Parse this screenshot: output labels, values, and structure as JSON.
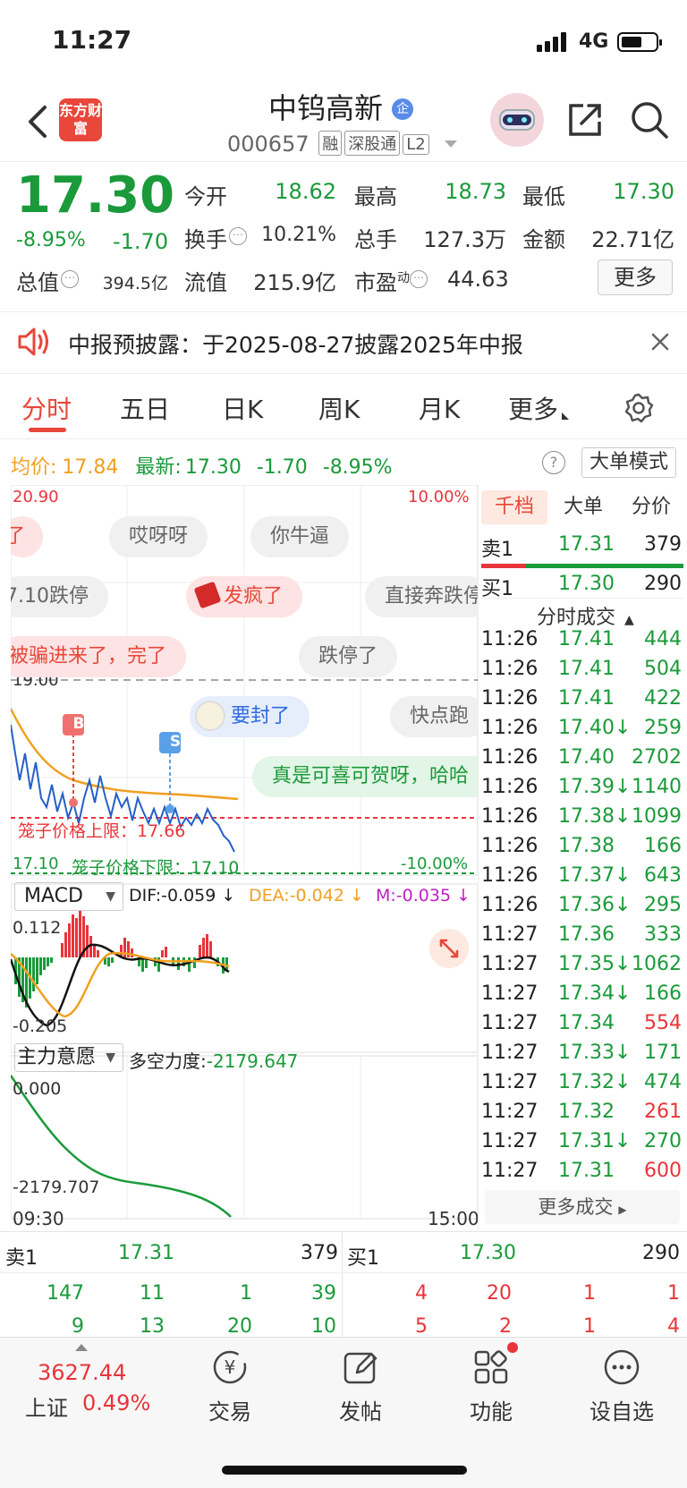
{
  "status": {
    "time": "11:27",
    "network": "4G"
  },
  "header": {
    "logo_text": "东方财富",
    "stock_name": "中钨高新",
    "badge": "企",
    "stock_code": "000657",
    "tags": [
      "融",
      "深股通",
      "L2"
    ]
  },
  "quote": {
    "price": "17.30",
    "pct": "-8.95%",
    "change": "-1.70",
    "open_label": "今开",
    "open": "18.62",
    "high_label": "最高",
    "high": "18.73",
    "low_label": "最低",
    "low": "17.30",
    "turnover_label": "换手",
    "turnover": "10.21%",
    "volume_label": "总手",
    "volume": "127.3万",
    "amount_label": "金额",
    "amount": "22.71亿",
    "mcap_label": "总值",
    "mcap": "394.5亿",
    "float_label": "流值",
    "float": "215.9亿",
    "pe_label": "市盈",
    "pe_sup": "动",
    "pe": "44.63",
    "more_label": "更多"
  },
  "notice": {
    "text": "中报预披露：于2025-08-27披露2025年中报"
  },
  "tabs": [
    "分时",
    "五日",
    "日K",
    "周K",
    "月K",
    "更多"
  ],
  "chart": {
    "avg_label": "均价:",
    "avg": "17.84",
    "latest_label": "最新:",
    "latest": "17.30",
    "latest_change": "-1.70",
    "latest_pct": "-8.95%",
    "big_order_mode": "大单模式",
    "top_price": "20.90",
    "top_pct": "10.00%",
    "mid_price": "19.00",
    "bottom_price": "17.10",
    "bottom_pct": "-10.00%",
    "upper_limit_text": "笼子价格上限：17.66",
    "lower_limit_text": "笼子价格下限：17.10",
    "b_marker": "B",
    "s_marker": "S",
    "time_start": "09:30",
    "time_end": "15:00",
    "bubbles": [
      "了",
      "哎呀呀",
      "你牛逼",
      "7.10跌停",
      "发疯了",
      "直接奔跌停",
      "被骗进来了，完了",
      "跌停了",
      "要封了",
      "快点跑",
      "真是可喜可贺呀，哈哈"
    ]
  },
  "macd": {
    "label": "MACD",
    "dif": "DIF:-0.059 ↓",
    "dea": "DEA:-0.042 ↓",
    "m": "M:-0.035 ↓",
    "top": "0.112",
    "bottom": "-0.205"
  },
  "flow": {
    "label": "主力意愿",
    "force_label": "多空力度:",
    "force": "-2179.647",
    "top": "0.000",
    "bottom": "-2179.707"
  },
  "orderbook": {
    "tabs": [
      "千档",
      "大单",
      "分价"
    ],
    "sell1_label": "卖1",
    "sell1_price": "17.31",
    "sell1_vol": "379",
    "buy1_label": "买1",
    "buy1_price": "17.30",
    "buy1_vol": "290",
    "trades_title": "分时成交",
    "trades": [
      {
        "t": "11:26",
        "p": "17.41",
        "v": "444",
        "c": "g"
      },
      {
        "t": "11:26",
        "p": "17.41",
        "v": "504",
        "c": "g"
      },
      {
        "t": "11:26",
        "p": "17.41",
        "v": "422",
        "c": "g"
      },
      {
        "t": "11:26",
        "p": "17.40↓",
        "v": "259",
        "c": "g"
      },
      {
        "t": "11:26",
        "p": "17.40",
        "v": "2702",
        "c": "g"
      },
      {
        "t": "11:26",
        "p": "17.39↓",
        "v": "1140",
        "c": "g"
      },
      {
        "t": "11:26",
        "p": "17.38↓",
        "v": "1099",
        "c": "g"
      },
      {
        "t": "11:26",
        "p": "17.38",
        "v": "166",
        "c": "g"
      },
      {
        "t": "11:26",
        "p": "17.37↓",
        "v": "643",
        "c": "g"
      },
      {
        "t": "11:26",
        "p": "17.36↓",
        "v": "295",
        "c": "g"
      },
      {
        "t": "11:27",
        "p": "17.36",
        "v": "333",
        "c": "g"
      },
      {
        "t": "11:27",
        "p": "17.35↓",
        "v": "1062",
        "c": "g"
      },
      {
        "t": "11:27",
        "p": "17.34↓",
        "v": "166",
        "c": "g"
      },
      {
        "t": "11:27",
        "p": "17.34",
        "v": "554",
        "c": "r"
      },
      {
        "t": "11:27",
        "p": "17.33↓",
        "v": "171",
        "c": "g"
      },
      {
        "t": "11:27",
        "p": "17.32↓",
        "v": "474",
        "c": "g"
      },
      {
        "t": "11:27",
        "p": "17.32",
        "v": "261",
        "c": "r"
      },
      {
        "t": "11:27",
        "p": "17.31↓",
        "v": "270",
        "c": "g"
      },
      {
        "t": "11:27",
        "p": "17.31",
        "v": "600",
        "c": "r"
      }
    ],
    "more_trades": "更多成交"
  },
  "bottom_book": {
    "sell_label": "卖1",
    "sell_price": "17.31",
    "sell_vol": "379",
    "buy_label": "买1",
    "buy_price": "17.30",
    "buy_vol": "290",
    "sell_orders_1": [
      "147",
      "11",
      "1",
      "39"
    ],
    "buy_orders_1": [
      "4",
      "20",
      "1",
      "1"
    ],
    "sell_orders_2": [
      "9",
      "13",
      "20",
      "10"
    ],
    "buy_orders_2": [
      "5",
      "2",
      "1",
      "4"
    ]
  },
  "nav": {
    "index_value": "3627.44",
    "index_name": "上证",
    "index_pct": "0.49%",
    "items": [
      "交易",
      "发帖",
      "功能",
      "设自选"
    ]
  }
}
